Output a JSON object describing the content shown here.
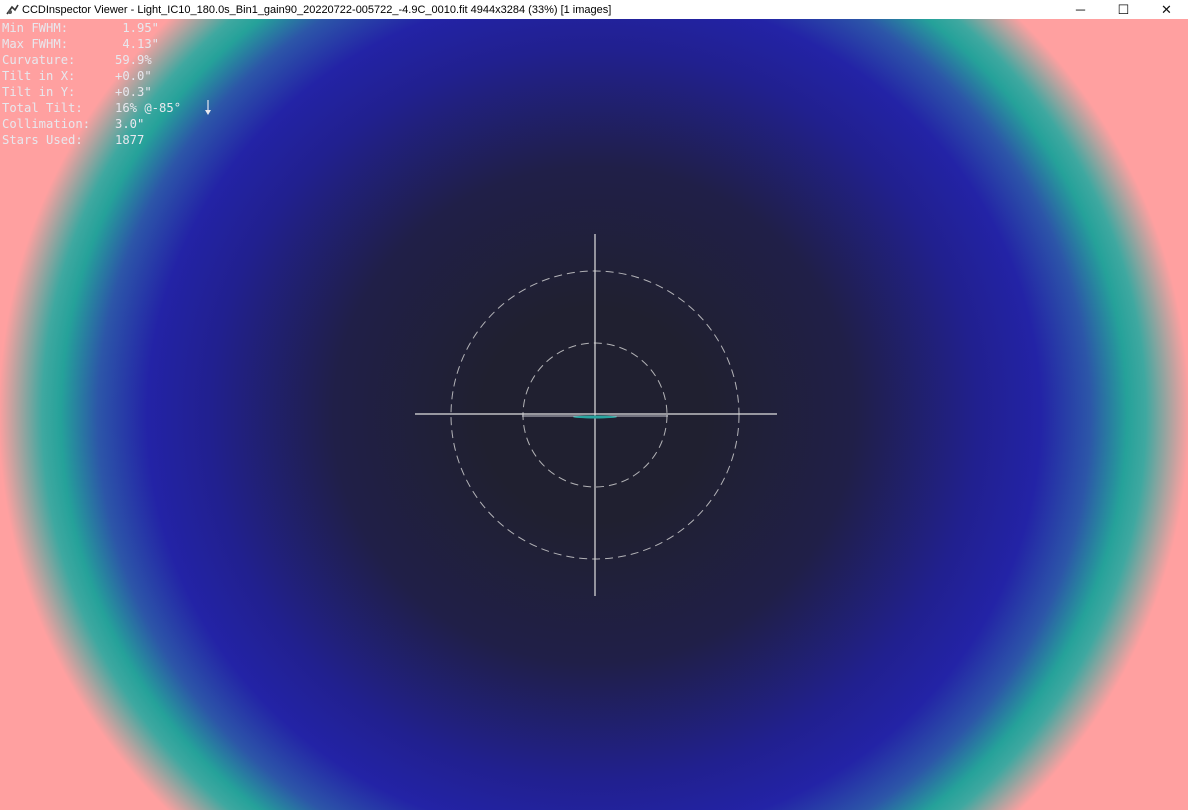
{
  "window": {
    "title": "CCDInspector Viewer - Light_IC10_180.0s_Bin1_gain90_20220722-005722_-4.9C_0010.fit 4944x3284 (33%)  [1 images]",
    "app_icon": "ccdinspector-app-icon",
    "controls": {
      "minimize": "─",
      "maximize": "☐",
      "close": "✕"
    }
  },
  "stats": {
    "min_fwhm": {
      "label": "Min FWHM:",
      "value": " 1.95\""
    },
    "max_fwhm": {
      "label": "Max FWHM:",
      "value": " 4.13\""
    },
    "curvature": {
      "label": "Curvature:",
      "value": "59.9%"
    },
    "tilt_x": {
      "label": "Tilt in X:",
      "value": "+0.0\""
    },
    "tilt_y": {
      "label": "Tilt in Y:",
      "value": "+0.3\""
    },
    "total_tilt": {
      "label": "Total Tilt:",
      "value": "16% @-85°"
    },
    "collimation": {
      "label": "Collimation:",
      "value": "3.0\""
    },
    "stars_used": {
      "label": "Stars Used:",
      "value": "1877"
    }
  },
  "icons": {
    "tilt_direction": "down-arrow-icon"
  },
  "colors": {
    "center": "#202030",
    "mid": "#2323a6",
    "ring": "#25a29a",
    "edge": "#ffa0a0",
    "overlay": "#d8d8d8"
  }
}
